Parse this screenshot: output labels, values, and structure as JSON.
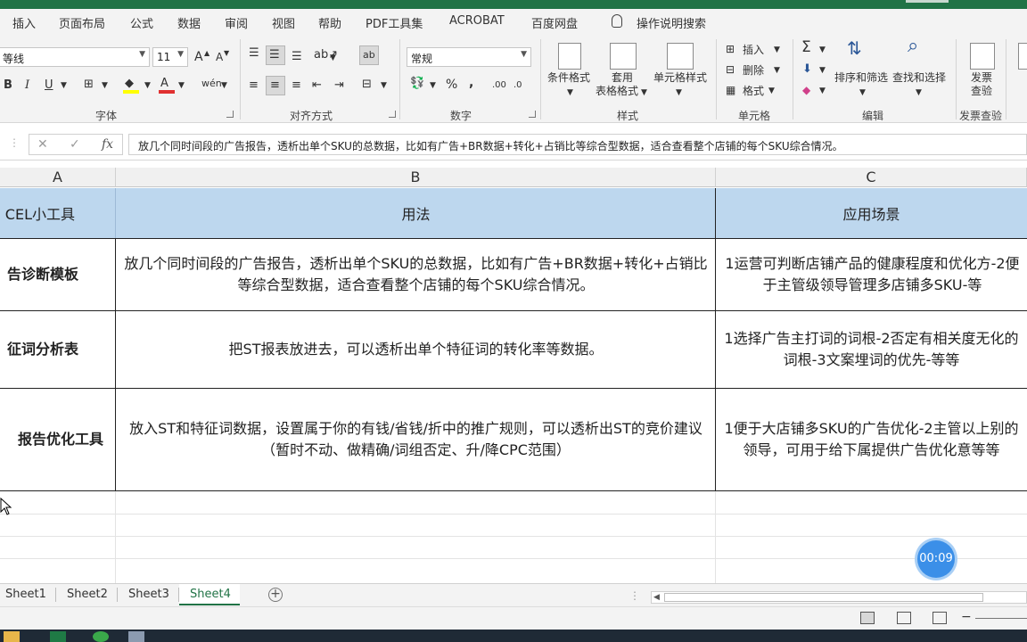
{
  "menu": {
    "tabs": [
      "插入",
      "页面布局",
      "公式",
      "数据",
      "审阅",
      "视图",
      "帮助",
      "PDF工具集",
      "ACROBAT",
      "百度网盘"
    ],
    "tell_me": "操作说明搜索"
  },
  "ribbon": {
    "font": {
      "name": "等线",
      "size": "11",
      "grow": "A",
      "shrink": "A",
      "bold": "B",
      "italic": "I",
      "underline": "U",
      "group_label": "字体"
    },
    "alignment": {
      "group_label": "对齐方式"
    },
    "number": {
      "format": "常规",
      "percent": "%",
      "comma": ",",
      "group_label": "数字"
    },
    "styles": {
      "conditional": "条件格式",
      "table_format": "套用",
      "table_format_2": "表格格式",
      "cell_styles": "单元格样式",
      "group_label": "样式"
    },
    "cells": {
      "insert": "插入",
      "delete": "删除",
      "format": "格式",
      "group_label": "单元格"
    },
    "editing": {
      "sort_filter": "排序和筛选",
      "find_select": "查找和选择",
      "group_label": "编辑"
    },
    "invoice": {
      "label_1": "发票",
      "label_2": "查验",
      "group_label": "发票查验"
    }
  },
  "formula_bar": {
    "fx": "fx",
    "content": "放几个同时间段的广告报告，透析出单个SKU的总数据，比如有广告+BR数据+转化+占销比等综合型数据，适合查看整个店铺的每个SKU综合情况。"
  },
  "sheet": {
    "columns": [
      "A",
      "B",
      "C"
    ],
    "header_row": [
      "CEL小工具",
      "用法",
      "应用场景"
    ],
    "rows": [
      {
        "a": "告诊断模板",
        "b": "放几个同时间段的广告报告，透析出单个SKU的总数据，比如有广告+BR数据+转化+占销比等综合型数据，适合查看整个店铺的每个SKU综合情况。",
        "c": "1运营可判断店铺产品的健康程度和优化方-2便于主管级领导管理多店铺多SKU-等"
      },
      {
        "a": "征词分析表",
        "b": "把ST报表放进去，可以透析出单个特征词的转化率等数据。",
        "c": "1选择广告主打词的词根-2否定有相关度无化的词根-3文案埋词的优先-等等"
      },
      {
        "a": "报告优化工具",
        "b": "放入ST和特征词数据，设置属于你的有钱/省钱/折中的推广规则，可以透析出ST的竞价建议（暂时不动、做精确/词组否定、升/降CPC范围）",
        "c": "1便于大店铺多SKU的广告优化-2主管以上别的领导，可用于给下属提供广告优化意等等"
      }
    ]
  },
  "sheet_tabs": [
    "Sheet1",
    "Sheet2",
    "Sheet3",
    "Sheet4"
  ],
  "active_sheet": "Sheet4",
  "add_sheet": "+",
  "timer": "00:09",
  "colors": {
    "excel_green": "#217346",
    "header_fill": "#bdd7ee",
    "timer_blue": "#3b8fe8"
  }
}
